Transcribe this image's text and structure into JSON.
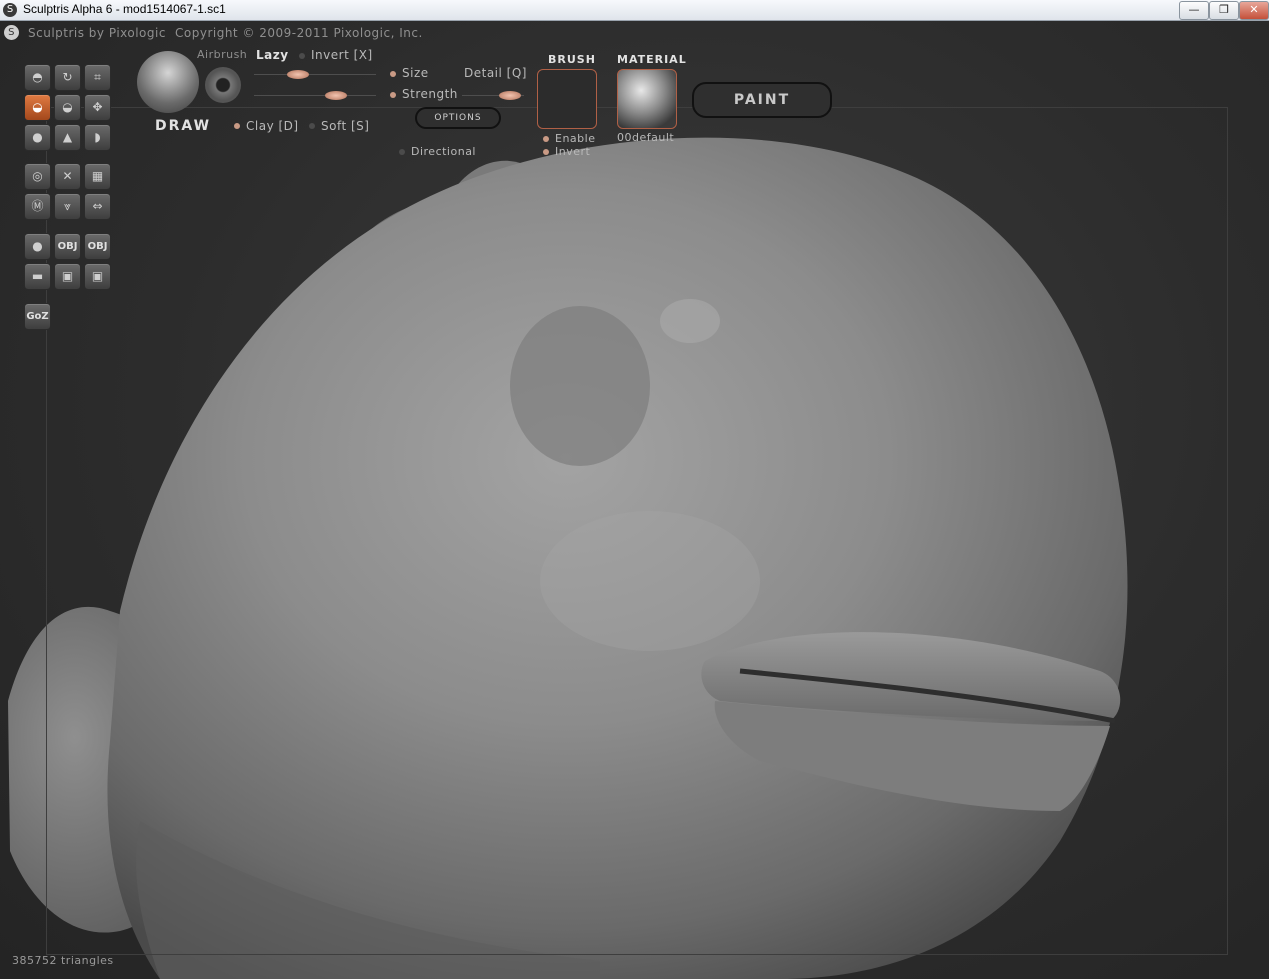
{
  "window": {
    "title": "Sculptris Alpha 6 - mod1514067-1.sc1",
    "buttons": {
      "minimize": "—",
      "maximize": "❐",
      "close": "✕"
    }
  },
  "header": {
    "brand": "Sculptris by Pixologic",
    "copyright": "Copyright © 2009-2011 Pixologic, Inc."
  },
  "brush_panel": {
    "tool_name": "DRAW",
    "airbrush_label": "Airbrush",
    "lazy_label": "Lazy",
    "invert_label": "Invert [X]",
    "size_label": "Size",
    "detail_label": "Detail [Q]",
    "strength_label": "Strength",
    "clay_label": "Clay [D]",
    "soft_label": "Soft [S]",
    "options_label": "OPTIONS",
    "directional_label": "Directional"
  },
  "brush_section": {
    "title": "BRUSH",
    "enable_label": "Enable",
    "invert_label": "Invert"
  },
  "material_section": {
    "title": "MATERIAL",
    "name": "00default"
  },
  "paint_button": {
    "label": "PAINT"
  },
  "toolbar": {
    "goz_label": "GoZ",
    "obj_label": "OBJ"
  },
  "status": {
    "triangle_count": "385752 triangles"
  },
  "colors": {
    "accent": "#d0733a",
    "slider_knob": "#e8b29c",
    "viewport_bg": "#2e2e2e"
  }
}
